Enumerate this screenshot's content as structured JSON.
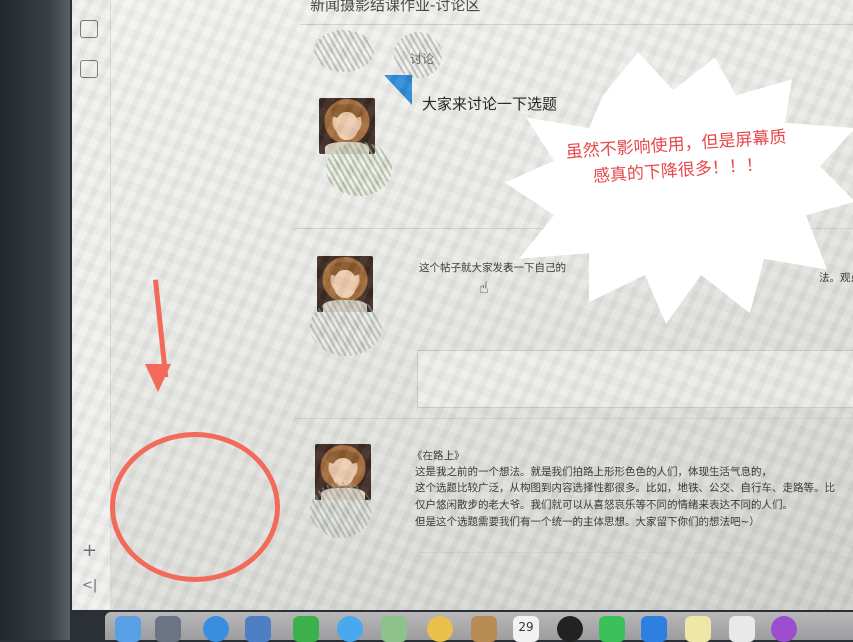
{
  "page": {
    "header_title": "新闻摄影结课作业-讨论区",
    "tag_label": "讨论"
  },
  "thread": {
    "title": "大家来讨论一下选题",
    "post_text_left": "这个帖子就大家发表一下自己的",
    "post_text_right": "法。观点和"
  },
  "reply": {
    "body_title": "《在路上》",
    "body_lines": [
      "这是我之前的一个想法。就是我们拍路上形形色色的人们，体现生活气息的，",
      "这个选题比较广泛，从构图到内容选择性都很多。比如，地铁、公交、自行车、走路等。比",
      "仅户悠闲散步的老大爷。我们就可以从喜怒哀乐等不同的情绪来表达不同的人们。",
      "但是这个选题需要我们有一个统一的主体思想。大家留下你们的想法吧~）"
    ]
  },
  "sidebar": {
    "add_symbol": "+",
    "collapse_symbol": "<|"
  },
  "dock": {
    "calendar_day": "29",
    "apps": [
      "finder-icon",
      "launchpad-icon",
      "safari-icon",
      "mail-icon",
      "facetime-icon",
      "messages-icon",
      "maps-icon",
      "photos-icon",
      "contacts-icon",
      "calendar-icon",
      "qq-icon",
      "wechat-icon",
      "xcode-icon",
      "notes-icon",
      "itunes-icon",
      "podcasts-icon"
    ]
  },
  "annotation": {
    "callout_text": "虽然不影响使用，但是屏幕质感真的下降很多！！！",
    "colors": {
      "annotation_red": "#f26a5a",
      "callout_text": "#e8474b",
      "badge_blue": "#2e8ad8"
    }
  }
}
